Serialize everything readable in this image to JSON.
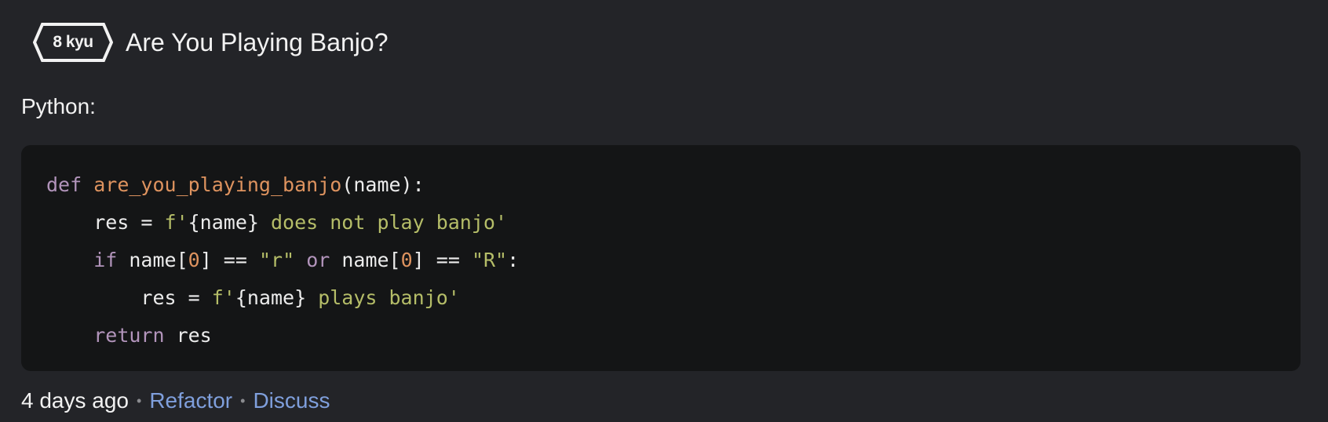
{
  "header": {
    "kyu": "8 kyu",
    "title": "Are You Playing Banjo?"
  },
  "language_label": "Python:",
  "code": {
    "lines": [
      [
        {
          "t": "def",
          "c": "kw"
        },
        {
          "t": " ",
          "c": "plain"
        },
        {
          "t": "are_you_playing_banjo",
          "c": "fn"
        },
        {
          "t": "(name):",
          "c": "plain"
        }
      ],
      [
        {
          "t": "    res = ",
          "c": "plain"
        },
        {
          "t": "f'",
          "c": "str"
        },
        {
          "t": "{name}",
          "c": "plain"
        },
        {
          "t": " does not play banjo'",
          "c": "str"
        }
      ],
      [
        {
          "t": "    ",
          "c": "plain"
        },
        {
          "t": "if",
          "c": "kw"
        },
        {
          "t": " name[",
          "c": "plain"
        },
        {
          "t": "0",
          "c": "num"
        },
        {
          "t": "] == ",
          "c": "plain"
        },
        {
          "t": "\"r\"",
          "c": "str"
        },
        {
          "t": " ",
          "c": "plain"
        },
        {
          "t": "or",
          "c": "kw"
        },
        {
          "t": " name[",
          "c": "plain"
        },
        {
          "t": "0",
          "c": "num"
        },
        {
          "t": "] == ",
          "c": "plain"
        },
        {
          "t": "\"R\"",
          "c": "str"
        },
        {
          "t": ":",
          "c": "plain"
        }
      ],
      [
        {
          "t": "        res = ",
          "c": "plain"
        },
        {
          "t": "f'",
          "c": "str"
        },
        {
          "t": "{name}",
          "c": "plain"
        },
        {
          "t": " plays banjo'",
          "c": "str"
        }
      ],
      [
        {
          "t": "    ",
          "c": "plain"
        },
        {
          "t": "return",
          "c": "kw"
        },
        {
          "t": " res",
          "c": "plain"
        }
      ]
    ]
  },
  "footer": {
    "time": "4 days ago",
    "separator": "•",
    "refactor": "Refactor",
    "discuss": "Discuss"
  },
  "colors": {
    "background": "#232428",
    "code_background": "#141516",
    "keyword": "#b294bb",
    "function": "#de935f",
    "string": "#b5bd68",
    "link": "#7f9fdc"
  }
}
